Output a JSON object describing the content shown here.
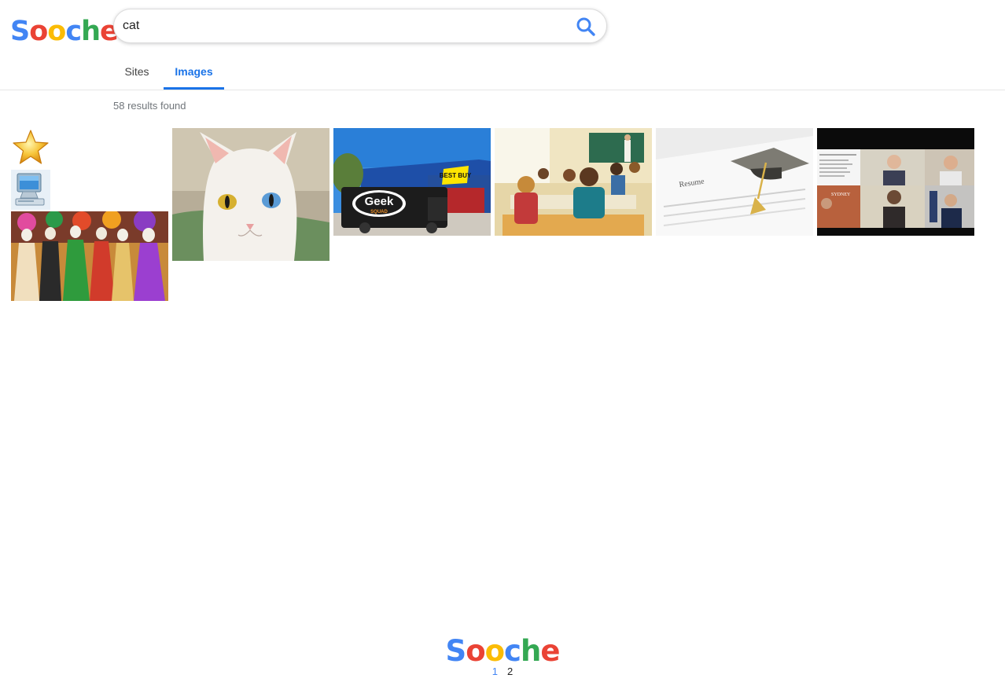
{
  "header": {
    "logo": {
      "letters": [
        "S",
        "o",
        "o",
        "c",
        "h",
        "e"
      ]
    },
    "search": {
      "value": "cat",
      "placeholder": "",
      "button_icon": "search-icon"
    }
  },
  "tabs": [
    {
      "label": "Sites",
      "active": false
    },
    {
      "label": "Images",
      "active": true
    }
  ],
  "results": {
    "count_text": "58 results found",
    "images": [
      {
        "name": "star-icon-image",
        "subject": "gold star icon"
      },
      {
        "name": "computer-icon-image",
        "subject": "desktop computer icon"
      },
      {
        "name": "catrina-dolls-image",
        "subject": "colorful skeleton figurines"
      },
      {
        "name": "white-cat-image",
        "subject": "white cat with heterochromatic eyes"
      },
      {
        "name": "best-buy-store-image",
        "subject": "Best Buy store with Geek Squad van"
      },
      {
        "name": "classroom-image",
        "subject": "children in a classroom"
      },
      {
        "name": "resume-graduation-cap-image",
        "subject": "resume with graduation cap"
      },
      {
        "name": "video-call-image",
        "subject": "video conference screenshot"
      }
    ],
    "embedded_text": {
      "best_buy": "BEST BUY",
      "geek": "Geek",
      "squad": "SQUAD",
      "resume": "Resume",
      "sydney": "SYDNEY"
    }
  },
  "footer": {
    "logo": {
      "letters": [
        "S",
        "o",
        "o",
        "c",
        "h",
        "e"
      ]
    },
    "pages": [
      "1",
      "2"
    ],
    "current_page": "1"
  },
  "colors": {
    "blue": "#4285f4",
    "red": "#ea4335",
    "yellow": "#fbbc05",
    "green": "#34a853",
    "tab_active": "#1a73e8"
  }
}
